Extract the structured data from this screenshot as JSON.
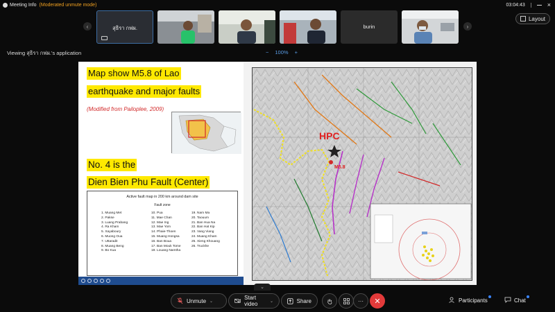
{
  "topbar": {
    "meeting_info_label": "Meeting Info",
    "moderated_label": "(Moderated unmute mode)",
    "time": "03:04:43"
  },
  "participants_strip": {
    "tiles": [
      {
        "name": "สุธิรา กฟผ.",
        "active": true
      },
      {
        "name": "",
        "active": false
      },
      {
        "name": "",
        "active": false
      },
      {
        "name": "",
        "active": false
      },
      {
        "name": "burin",
        "active": false
      },
      {
        "name": "",
        "active": false
      }
    ],
    "layout_label": "Layout"
  },
  "viewing": {
    "label": "Viewing สุธิรา กฟผ.'s application",
    "zoom_value": "100%",
    "zoom_out": "−",
    "zoom_in": "+"
  },
  "slide": {
    "line1": "Map show M5.8 of Lao",
    "line2": "earthquake and major faults",
    "line3": "(Modified from Pailoplee, 2009)",
    "line4": "No. 4 is the",
    "line5": "Dien Bien Phu Fault (Center)",
    "table_title": "Active fault map in 200 km around dam site",
    "table_sub": "Fault zone",
    "col1": [
      "1. Muang Met",
      "2. Pakse",
      "3. Luang Prabang",
      "4. Ra Kham",
      "5. Xayaboury",
      "6. Muong Oua",
      "7. Uttaradit",
      "8. Muang Beng",
      "9. Bo Kua"
    ],
    "col2": [
      "10. Pua",
      "11. Mae Chan",
      "12. Mae Ing",
      "13. Mae Yom",
      "14. Phaie-Thoen",
      "15. Muang Hongsa",
      "16. Ban Boua",
      "17. Ban Mouk Tome",
      "18. Louang Namtha"
    ],
    "col3": [
      "19. Nam Ma",
      "20. Taouum",
      "21. Ban Hua Na",
      "22. Ban Hat Kip",
      "23. Vang Viang",
      "24. Muang Kham",
      "25. Xieng Khouang",
      "26. Truckhe"
    ],
    "map_label_hpc": "HPC",
    "map_label_m58": "M5.8"
  },
  "controls": {
    "unmute_label": "Unmute",
    "start_video_label": "Start video",
    "share_label": "Share",
    "more_label": "···",
    "end_label": "✕",
    "participants_label": "Participants",
    "chat_label": "Chat"
  },
  "colors": {
    "accent": "#3a86ff",
    "highlight": "#ffe900",
    "end_call": "#e23a3a",
    "moderated": "#f0a020"
  }
}
